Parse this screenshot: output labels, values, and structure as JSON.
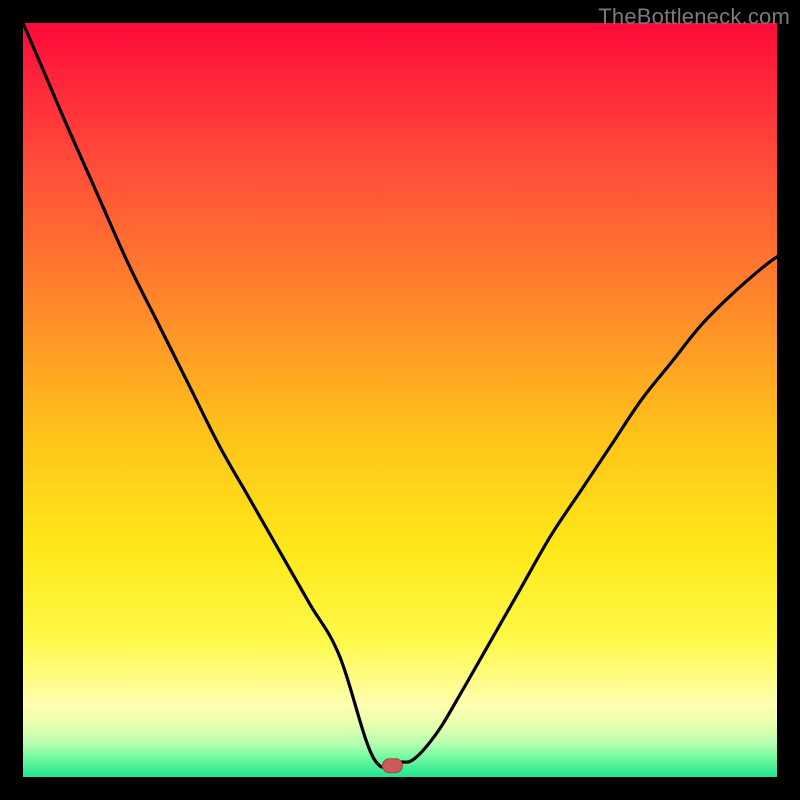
{
  "watermark": "TheBottleneck.com",
  "colors": {
    "frame": "#000000",
    "curve_stroke": "#000000",
    "marker_fill": "#cc5a5a",
    "marker_stroke": "#a84242",
    "gradient_stops": [
      {
        "offset": 0.0,
        "color": "#ff0a3a"
      },
      {
        "offset": 0.18,
        "color": "#ff4a3a"
      },
      {
        "offset": 0.38,
        "color": "#ff8a2a"
      },
      {
        "offset": 0.55,
        "color": "#ffc41a"
      },
      {
        "offset": 0.7,
        "color": "#ffe81a"
      },
      {
        "offset": 0.82,
        "color": "#fff94a"
      },
      {
        "offset": 0.905,
        "color": "#ffffb0"
      },
      {
        "offset": 0.93,
        "color": "#e8ffb0"
      },
      {
        "offset": 0.955,
        "color": "#b8ffb0"
      },
      {
        "offset": 0.975,
        "color": "#70f9a0"
      },
      {
        "offset": 1.0,
        "color": "#1fe690"
      }
    ]
  },
  "chart_data": {
    "type": "line",
    "title": "",
    "xlabel": "",
    "ylabel": "",
    "xlim": [
      0,
      1
    ],
    "ylim": [
      0,
      1
    ],
    "marker": {
      "x": 0.49,
      "y": 0.015
    },
    "series": [
      {
        "name": "curve",
        "x": [
          0.0,
          0.03,
          0.06,
          0.1,
          0.14,
          0.18,
          0.22,
          0.26,
          0.3,
          0.34,
          0.38,
          0.42,
          0.465,
          0.5,
          0.52,
          0.55,
          0.58,
          0.62,
          0.66,
          0.7,
          0.74,
          0.78,
          0.82,
          0.86,
          0.9,
          0.94,
          0.98,
          1.0
        ],
        "y": [
          1.0,
          0.93,
          0.86,
          0.77,
          0.68,
          0.6,
          0.52,
          0.44,
          0.37,
          0.3,
          0.23,
          0.16,
          0.025,
          0.02,
          0.025,
          0.06,
          0.11,
          0.18,
          0.25,
          0.32,
          0.38,
          0.44,
          0.5,
          0.55,
          0.6,
          0.64,
          0.675,
          0.69
        ]
      }
    ]
  }
}
